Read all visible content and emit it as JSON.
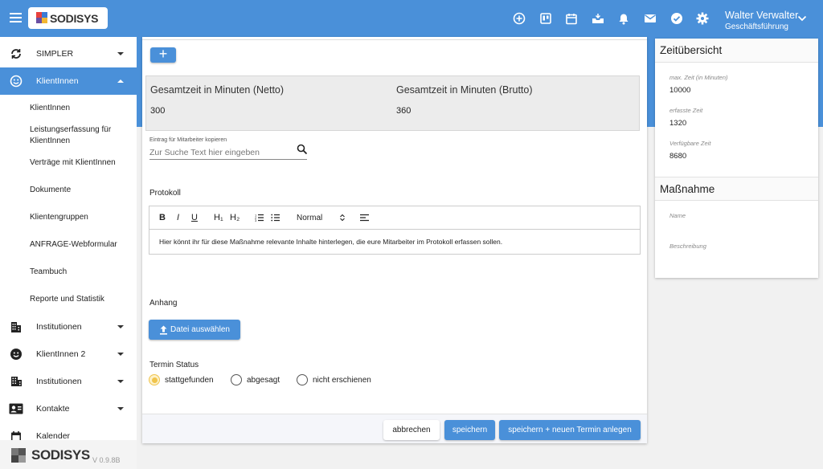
{
  "header": {
    "logo_text": "SODISYS",
    "user_name": "Walter Verwalter",
    "user_role": "Geschäftsführung",
    "icons": [
      "plus-circle-icon",
      "board-icon",
      "calendar-icon",
      "inbox-icon",
      "bell-icon",
      "mail-icon",
      "check-circle-icon",
      "gear-icon"
    ]
  },
  "sidebar": {
    "items": [
      {
        "label": "SIMPLER",
        "icon": "sync-icon"
      },
      {
        "label": "KlientInnen",
        "icon": "smiley-icon"
      },
      {
        "label": "Institutionen",
        "icon": "building-icon"
      },
      {
        "label": "KlientInnen 2",
        "icon": "face-icon"
      },
      {
        "label": "Institutionen",
        "icon": "buildings-icon"
      },
      {
        "label": "Kontakte",
        "icon": "contacts-icon"
      },
      {
        "label": "Kalender",
        "icon": "calendar-icon"
      }
    ],
    "sub_items": [
      "KlientInnen",
      "Leistungserfassung für KlientInnen",
      "Verträge mit KlientInnen",
      "Dokumente",
      "Klientengruppen",
      "ANFRAGE-Webformular",
      "Teambuch",
      "Reporte und Statistik"
    ],
    "footer_logo": "SODISYS",
    "version": "V 0.9.8B"
  },
  "main": {
    "netto_label": "Gesamtzeit in Minuten (Netto)",
    "netto_value": "300",
    "brutto_label": "Gesamtzeit in Minuten (Brutto)",
    "brutto_value": "360",
    "copy_label": "Eintrag für Mitarbeiter kopieren",
    "search_placeholder": "Zur Suche Text hier eingeben",
    "protokoll_label": "Protokoll",
    "editor": {
      "bold": "B",
      "italic": "I",
      "underline": "U",
      "h1": "H₁",
      "h2": "H₂",
      "format_select": "Normal",
      "content": "Hier könnt ihr für diese Maßnahme relevante Inhalte hinterlegen, die eure Mitarbeiter im Protokoll erfassen sollen."
    },
    "anhang_label": "Anhang",
    "upload_label": "Datei auswählen",
    "status_label": "Termin Status",
    "radios": [
      "stattgefunden",
      "abgesagt",
      "nicht erschienen"
    ],
    "selected_radio": "stattgefunden",
    "buttons": {
      "cancel": "abbrechen",
      "save": "speichern",
      "save_new": "speichern + neuen Termin anlegen"
    }
  },
  "right_panel": {
    "time_title": "Zeitübersicht",
    "max_label": "max. Zeit (in Minuten)",
    "max_value": "10000",
    "recorded_label": "erfasste Zeit",
    "recorded_value": "1320",
    "available_label": "Verfügbare Zeit",
    "available_value": "8680",
    "measure_title": "Maßnahme",
    "name_label": "Name",
    "desc_label": "Beschreibung"
  },
  "colors": {
    "primary": "#4a90d9",
    "radio_selected": "#f0c44c"
  }
}
